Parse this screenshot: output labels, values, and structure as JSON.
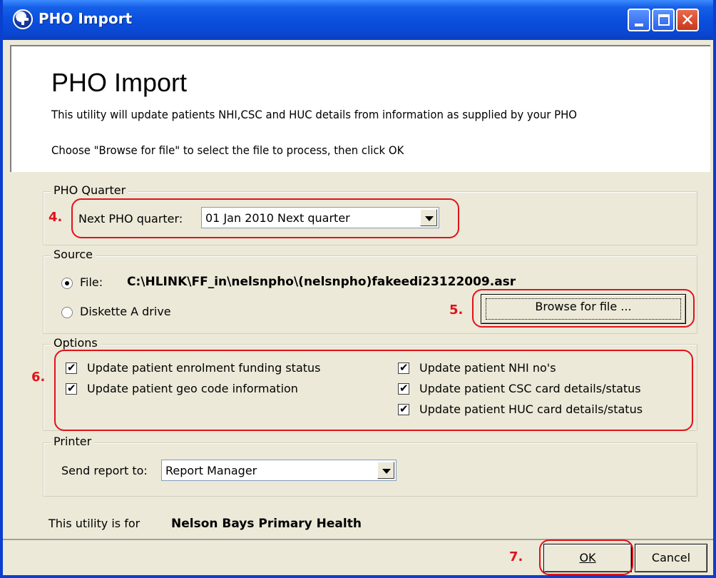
{
  "window": {
    "title": "PHO Import"
  },
  "header": {
    "title": "PHO Import",
    "line1": "This utility will update patients NHI,CSC and HUC details from information as supplied by your PHO",
    "line2": "Choose \"Browse for file\" to select the file to process, then click OK"
  },
  "quarter": {
    "group_label": "PHO Quarter",
    "label": "Next PHO quarter:",
    "value": "01 Jan 2010 Next quarter"
  },
  "source": {
    "group_label": "Source",
    "file_label": "File:",
    "file_path": "C:\\HLINK\\FF_in\\nelsnpho\\(nelsnpho)fakeedi23122009.asr",
    "diskette_label": "Diskette A drive",
    "browse_label": "Browse for file ..."
  },
  "options": {
    "group_label": "Options",
    "items": [
      {
        "label": "Update patient enrolment funding status",
        "checked": true
      },
      {
        "label": "Update patient geo code information",
        "checked": true
      },
      {
        "label": "Update patient NHI no's",
        "checked": true
      },
      {
        "label": "Update patient CSC card details/status",
        "checked": true
      },
      {
        "label": "Update patient HUC card details/status",
        "checked": true
      }
    ]
  },
  "printer": {
    "group_label": "Printer",
    "label": "Send report to:",
    "value": "Report Manager"
  },
  "footer": {
    "utility_prefix": "This utility is for",
    "org_name": "Nelson Bays Primary Health",
    "ok_label": "OK",
    "cancel_label": "Cancel"
  },
  "annotations": {
    "n4": "4.",
    "n5": "5.",
    "n6": "6.",
    "n7": "7."
  },
  "colors": {
    "annotation_red": "#e0121b",
    "titlebar_blue": "#0a4fde",
    "dialog_bg": "#ece9d8"
  }
}
